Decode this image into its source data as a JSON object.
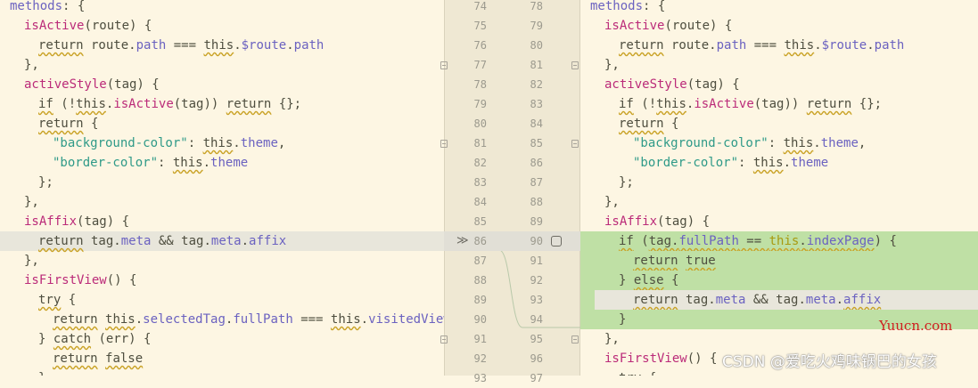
{
  "left_lines": [
    {
      "ind": 0,
      "toks": [
        [
          "pr",
          "methods"
        ],
        [
          "op",
          ": {"
        ]
      ]
    },
    {
      "ind": 2,
      "toks": [
        [
          "fn",
          "isActive"
        ],
        [
          "op",
          "(route) {"
        ]
      ]
    },
    {
      "ind": 4,
      "toks": [
        [
          "kw",
          "return"
        ],
        [
          "op",
          " route."
        ],
        [
          "pr",
          "path"
        ],
        [
          "op",
          " === "
        ],
        [
          "kw",
          "this"
        ],
        [
          "op",
          "."
        ],
        [
          "pr",
          "$route"
        ],
        [
          "op",
          "."
        ],
        [
          "pr",
          "path"
        ]
      ]
    },
    {
      "ind": 2,
      "toks": [
        [
          "op",
          "},"
        ]
      ]
    },
    {
      "ind": 2,
      "toks": [
        [
          "fn",
          "activeStyle"
        ],
        [
          "op",
          "(tag) {"
        ]
      ]
    },
    {
      "ind": 4,
      "toks": [
        [
          "kw",
          "if"
        ],
        [
          "op",
          " (!"
        ],
        [
          "kw",
          "this"
        ],
        [
          "op",
          "."
        ],
        [
          "fn",
          "isActive"
        ],
        [
          "op",
          "(tag)) "
        ],
        [
          "kw",
          "return"
        ],
        [
          "op",
          " {};"
        ]
      ]
    },
    {
      "ind": 4,
      "toks": [
        [
          "kw",
          "return"
        ],
        [
          "op",
          " {"
        ]
      ]
    },
    {
      "ind": 6,
      "toks": [
        [
          "st",
          "\"background-color\""
        ],
        [
          "op",
          ": "
        ],
        [
          "kw",
          "this"
        ],
        [
          "op",
          "."
        ],
        [
          "pr",
          "theme"
        ],
        [
          "op",
          ","
        ]
      ]
    },
    {
      "ind": 6,
      "toks": [
        [
          "st",
          "\"border-color\""
        ],
        [
          "op",
          ": "
        ],
        [
          "kw",
          "this"
        ],
        [
          "op",
          "."
        ],
        [
          "pr",
          "theme"
        ]
      ]
    },
    {
      "ind": 4,
      "toks": [
        [
          "op",
          "};"
        ]
      ]
    },
    {
      "ind": 2,
      "toks": [
        [
          "op",
          "},"
        ]
      ]
    },
    {
      "ind": 2,
      "toks": [
        [
          "fn",
          "isAffix"
        ],
        [
          "op",
          "(tag) {"
        ]
      ]
    },
    {
      "ind": 4,
      "toks": [
        [
          "kw",
          "return"
        ],
        [
          "op",
          " tag."
        ],
        [
          "pr",
          "meta"
        ],
        [
          "op",
          " && tag."
        ],
        [
          "pr",
          "meta"
        ],
        [
          "op",
          "."
        ],
        [
          "pr",
          "affix"
        ]
      ],
      "hl": true
    },
    {
      "ind": 2,
      "toks": [
        [
          "op",
          "},"
        ]
      ]
    },
    {
      "ind": 2,
      "toks": [
        [
          "fn",
          "isFirstView"
        ],
        [
          "op",
          "() {"
        ]
      ]
    },
    {
      "ind": 4,
      "toks": [
        [
          "kw",
          "try"
        ],
        [
          "op",
          " {"
        ]
      ]
    },
    {
      "ind": 6,
      "toks": [
        [
          "kw",
          "return"
        ],
        [
          "op",
          " "
        ],
        [
          "kw",
          "this"
        ],
        [
          "op",
          "."
        ],
        [
          "pr",
          "selectedTag"
        ],
        [
          "op",
          "."
        ],
        [
          "pr",
          "fullPath"
        ],
        [
          "op",
          " === "
        ],
        [
          "kw",
          "this"
        ],
        [
          "op",
          "."
        ],
        [
          "pr",
          "visitedViews"
        ]
      ]
    },
    {
      "ind": 4,
      "toks": [
        [
          "op",
          "} "
        ],
        [
          "kw",
          "catch"
        ],
        [
          "op",
          " (err) {"
        ]
      ]
    },
    {
      "ind": 6,
      "toks": [
        [
          "kw",
          "return"
        ],
        [
          "op",
          " "
        ],
        [
          "kw",
          "false"
        ]
      ]
    },
    {
      "ind": 4,
      "toks": [
        [
          "op",
          "}"
        ]
      ]
    }
  ],
  "right_lines": [
    {
      "ind": 0,
      "toks": [
        [
          "pr",
          "methods"
        ],
        [
          "op",
          ": {"
        ]
      ]
    },
    {
      "ind": 2,
      "toks": [
        [
          "fn",
          "isActive"
        ],
        [
          "op",
          "(route) {"
        ]
      ]
    },
    {
      "ind": 4,
      "toks": [
        [
          "kw",
          "return"
        ],
        [
          "op",
          " route."
        ],
        [
          "pr",
          "path"
        ],
        [
          "op",
          " === "
        ],
        [
          "kw",
          "this"
        ],
        [
          "op",
          "."
        ],
        [
          "pr",
          "$route"
        ],
        [
          "op",
          "."
        ],
        [
          "pr",
          "path"
        ]
      ]
    },
    {
      "ind": 2,
      "toks": [
        [
          "op",
          "},"
        ]
      ]
    },
    {
      "ind": 2,
      "toks": [
        [
          "fn",
          "activeStyle"
        ],
        [
          "op",
          "(tag) {"
        ]
      ]
    },
    {
      "ind": 4,
      "toks": [
        [
          "kw",
          "if"
        ],
        [
          "op",
          " (!"
        ],
        [
          "kw",
          "this"
        ],
        [
          "op",
          "."
        ],
        [
          "fn",
          "isActive"
        ],
        [
          "op",
          "(tag)) "
        ],
        [
          "kw",
          "return"
        ],
        [
          "op",
          " {};"
        ]
      ]
    },
    {
      "ind": 4,
      "toks": [
        [
          "kw",
          "return"
        ],
        [
          "op",
          " {"
        ]
      ]
    },
    {
      "ind": 6,
      "toks": [
        [
          "st",
          "\"background-color\""
        ],
        [
          "op",
          ": "
        ],
        [
          "kw",
          "this"
        ],
        [
          "op",
          "."
        ],
        [
          "pr",
          "theme"
        ],
        [
          "op",
          ","
        ]
      ]
    },
    {
      "ind": 6,
      "toks": [
        [
          "st",
          "\"border-color\""
        ],
        [
          "op",
          ": "
        ],
        [
          "kw",
          "this"
        ],
        [
          "op",
          "."
        ],
        [
          "pr",
          "theme"
        ]
      ]
    },
    {
      "ind": 4,
      "toks": [
        [
          "op",
          "};"
        ]
      ]
    },
    {
      "ind": 2,
      "toks": [
        [
          "op",
          "},"
        ]
      ]
    },
    {
      "ind": 2,
      "toks": [
        [
          "fn",
          "isAffix"
        ],
        [
          "op",
          "(tag) {"
        ]
      ]
    },
    {
      "ind": 4,
      "toks": [
        [
          "kw",
          "if"
        ],
        [
          "op",
          " ("
        ],
        [
          "opw",
          "tag."
        ],
        [
          "prw",
          "fullPath"
        ],
        [
          "opw",
          " == "
        ],
        [
          "kww",
          "this"
        ],
        [
          "opw",
          "."
        ],
        [
          "prw",
          "indexPage"
        ],
        [
          "op",
          ") {"
        ]
      ],
      "add": true
    },
    {
      "ind": 6,
      "toks": [
        [
          "kw",
          "return"
        ],
        [
          "op",
          " "
        ],
        [
          "kw",
          "true"
        ]
      ],
      "add": true
    },
    {
      "ind": 4,
      "toks": [
        [
          "op",
          "} "
        ],
        [
          "kw",
          "else"
        ],
        [
          "op",
          " {"
        ]
      ],
      "add": true
    },
    {
      "ind": 6,
      "toks": [
        [
          "kw",
          "return"
        ],
        [
          "op",
          " tag."
        ],
        [
          "pr",
          "meta"
        ],
        [
          "op",
          " && tag."
        ],
        [
          "pr",
          "meta"
        ],
        [
          "op",
          "."
        ],
        [
          "prw",
          "affix"
        ]
      ],
      "add": true,
      "hl": true
    },
    {
      "ind": 4,
      "toks": [
        [
          "op",
          "}"
        ]
      ],
      "add": true
    },
    {
      "ind": 2,
      "toks": [
        [
          "op",
          "},"
        ]
      ]
    },
    {
      "ind": 2,
      "toks": [
        [
          "fn",
          "isFirstView"
        ],
        [
          "op",
          "() {"
        ]
      ]
    },
    {
      "ind": 4,
      "toks": [
        [
          "kw",
          "try"
        ],
        [
          "op",
          " {"
        ]
      ]
    }
  ],
  "gutter": {
    "left_numbers": [
      "74",
      "75",
      "76",
      "77",
      "78",
      "79",
      "80",
      "81",
      "82",
      "83",
      "84",
      "85",
      "86",
      "87",
      "88",
      "89",
      "90",
      "91",
      "92",
      "93"
    ],
    "right_numbers": [
      "78",
      "79",
      "80",
      "81",
      "82",
      "83",
      "84",
      "85",
      "86",
      "87",
      "88",
      "89",
      "90",
      "91",
      "92",
      "93",
      "94",
      "95",
      "96",
      "97"
    ]
  },
  "watermark": {
    "site": "Yuucn.com",
    "author": "CSDN @爱吃火鸡味锅巴的女孩"
  }
}
